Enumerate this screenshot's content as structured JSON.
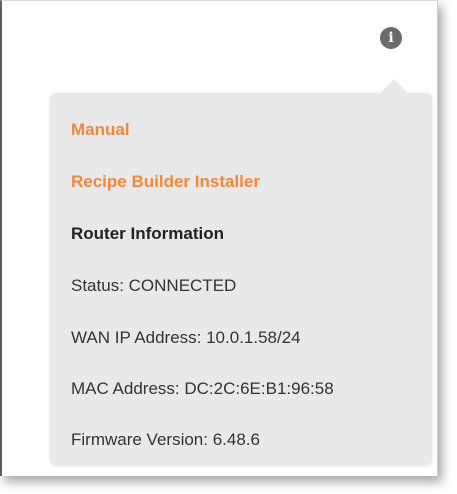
{
  "icons": {
    "info": "info-icon"
  },
  "colors": {
    "link": "#f0883e",
    "popover_background": "#e9e9e9",
    "icon_background": "#6b6b6b"
  },
  "popover": {
    "links": {
      "manual": "Manual",
      "recipe_builder_installer": "Recipe Builder Installer"
    },
    "router_info": {
      "heading": "Router Information",
      "status": "Status: CONNECTED",
      "wan_ip": "WAN IP Address: 10.0.1.58/24",
      "mac": "MAC Address: DC:2C:6E:B1:96:58",
      "firmware": "Firmware Version: 6.48.6"
    }
  }
}
